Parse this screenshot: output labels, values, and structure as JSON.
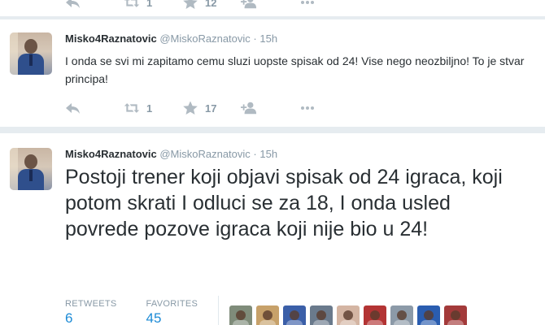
{
  "top_actions": {
    "retweets": "1",
    "favorites": "12"
  },
  "tweet1": {
    "name": "Misko4Raznatovic",
    "handle": "@MiskoRaznatovic",
    "separator": "·",
    "time": "15h",
    "text": "I onda se svi mi zapitamo cemu sluzi uopste spisak od 24! Vise nego neozbiljno! To je stvar principa!",
    "retweets": "1",
    "favorites": "17"
  },
  "tweet2": {
    "name": "Misko4Raznatovic",
    "handle": "@MiskoRaznatovic",
    "separator": "·",
    "time": "15h",
    "text": "Postoji trener koji objavi spisak od 24 igraca, koji potom skrati I odluci se za 18, I onda usled povrede pozove igraca koji nije bio u 24!",
    "retweets_label": "RETWEETS",
    "retweets": "6",
    "favorites_label": "FAVORITES",
    "favorites": "45"
  },
  "icons": [
    "reply-icon",
    "retweet-icon",
    "star-icon",
    "follow-icon",
    "more-icon"
  ],
  "colors": {
    "background": "#e6ecf0",
    "link": "#1d8bd6",
    "muted": "#8899a6",
    "icon": "#b0bac2"
  },
  "favoriter_thumbs": [
    "#7f8c7a",
    "#c7a16a",
    "#3b5fa8",
    "#6a7a8c",
    "#d4b5a3",
    "#b33434",
    "#8c9aa8",
    "#2a5db0",
    "#a33a3a"
  ]
}
